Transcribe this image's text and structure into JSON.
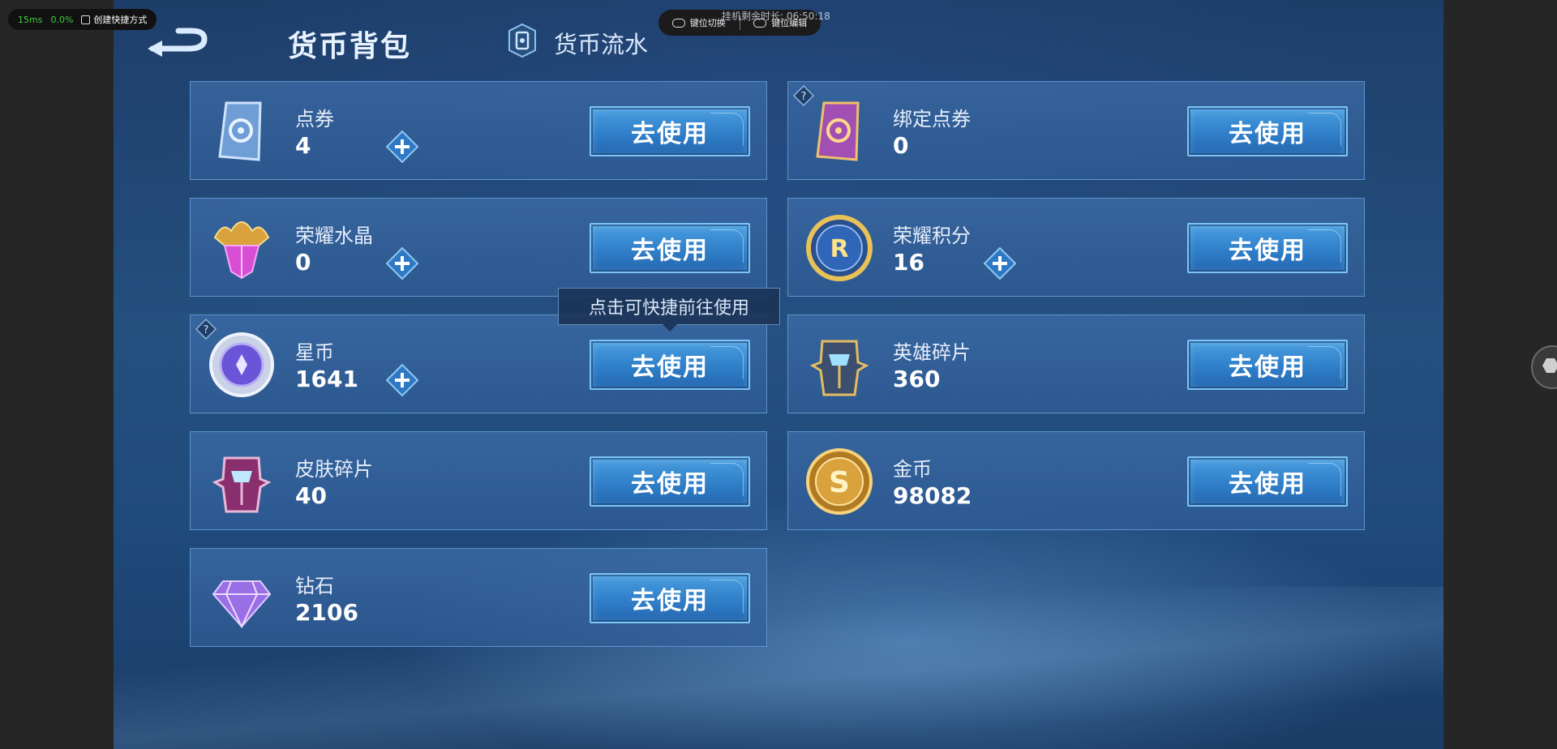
{
  "overlay": {
    "latency": "15ms",
    "cpu": "0.0%",
    "shortcut_label": "创建快捷方式",
    "key_switch": "键位切换",
    "key_edit": "键位编辑",
    "timer": "挂机剩余时长: 06:50:18"
  },
  "header": {
    "title": "货币背包",
    "flow_tab": "货币流水"
  },
  "use_label": "去使用",
  "tooltip": "点击可快捷前往使用",
  "currencies": [
    {
      "name": "点券",
      "value": "4",
      "icon": "voucher-card-icon"
    },
    {
      "name": "绑定点券",
      "value": "0",
      "icon": "bound-voucher-card-icon"
    },
    {
      "name": "荣耀水晶",
      "value": "0",
      "icon": "glory-crystal-icon"
    },
    {
      "name": "荣耀积分",
      "value": "16",
      "icon": "glory-points-icon"
    },
    {
      "name": "星币",
      "value": "1641",
      "icon": "star-coin-icon"
    },
    {
      "name": "英雄碎片",
      "value": "360",
      "icon": "hero-fragment-icon"
    },
    {
      "name": "皮肤碎片",
      "value": "40",
      "icon": "skin-fragment-icon"
    },
    {
      "name": "金币",
      "value": "98082",
      "icon": "gold-coin-icon"
    },
    {
      "name": "钻石",
      "value": "2106",
      "icon": "diamond-icon"
    }
  ]
}
